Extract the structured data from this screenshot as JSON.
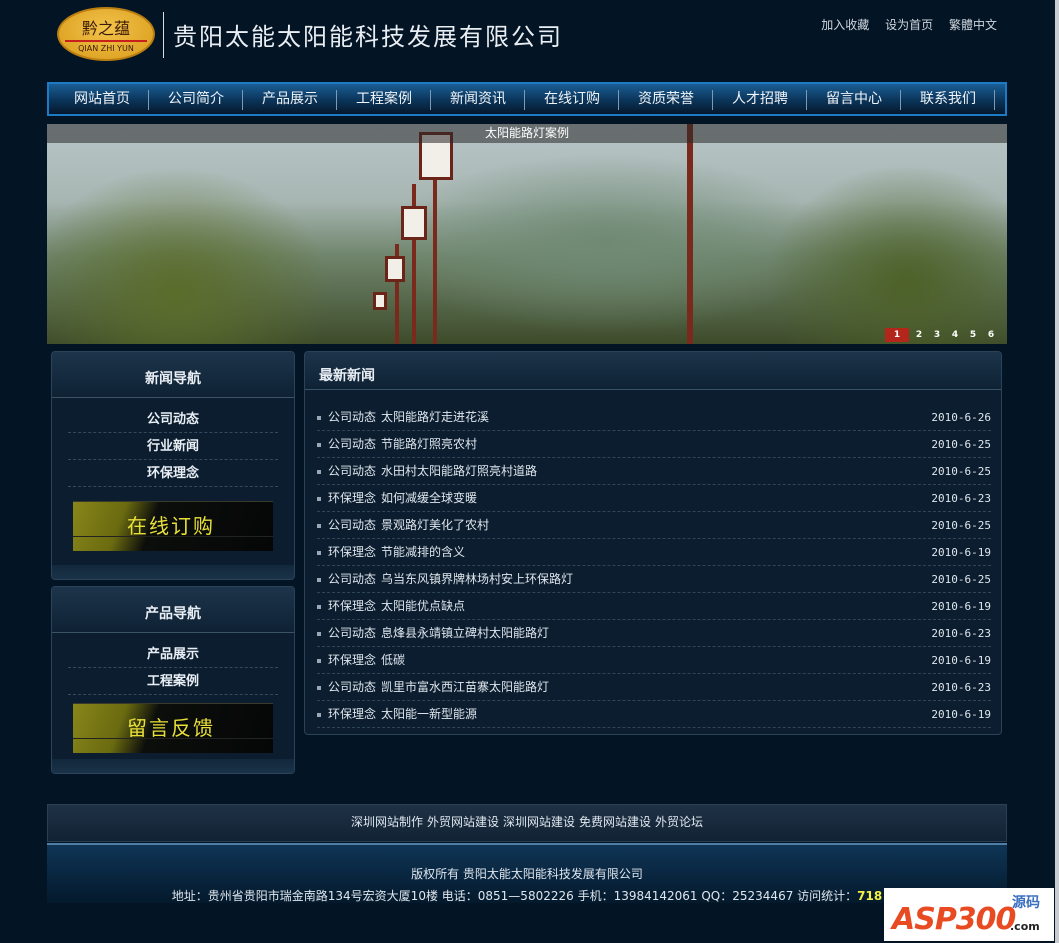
{
  "header": {
    "logo_cn": "黔之蕴",
    "logo_en": "QIAN ZHI YUN",
    "company": "贵阳太能太阳能科技发展有限公司",
    "top_links": [
      "加入收藏",
      "设为首页",
      "繁體中文"
    ]
  },
  "nav": [
    "网站首页",
    "公司简介",
    "产品展示",
    "工程案例",
    "新闻资讯",
    "在线订购",
    "资质荣誉",
    "人才招聘",
    "留言中心",
    "联系我们"
  ],
  "banner": {
    "caption": "太阳能路灯案例",
    "pages": [
      "1",
      "2",
      "3",
      "4",
      "5",
      "6"
    ],
    "active_page": "1"
  },
  "news_nav": {
    "title": "新闻导航",
    "items": [
      "公司动态",
      "行业新闻",
      "环保理念"
    ],
    "promo": "在线订购"
  },
  "product_nav": {
    "title": "产品导航",
    "items": [
      "产品展示",
      "工程案例"
    ],
    "promo": "留言反馈"
  },
  "latest_news": {
    "title": "最新新闻",
    "items": [
      {
        "cat": "公司动态",
        "title": "太阳能路灯走进花溪",
        "date": "2010-6-26"
      },
      {
        "cat": "公司动态",
        "title": "节能路灯照亮农村",
        "date": "2010-6-25"
      },
      {
        "cat": "公司动态",
        "title": "水田村太阳能路灯照亮村道路",
        "date": "2010-6-25"
      },
      {
        "cat": "环保理念",
        "title": "如何减缓全球变暖",
        "date": "2010-6-23"
      },
      {
        "cat": "公司动态",
        "title": "景观路灯美化了农村",
        "date": "2010-6-25"
      },
      {
        "cat": "环保理念",
        "title": "节能减排的含义",
        "date": "2010-6-19"
      },
      {
        "cat": "公司动态",
        "title": "乌当东风镇界牌林场村安上环保路灯",
        "date": "2010-6-25"
      },
      {
        "cat": "环保理念",
        "title": "太阳能优点缺点",
        "date": "2010-6-19"
      },
      {
        "cat": "公司动态",
        "title": "息烽县永靖镇立碑村太阳能路灯",
        "date": "2010-6-23"
      },
      {
        "cat": "环保理念",
        "title": "低碳",
        "date": "2010-6-19"
      },
      {
        "cat": "公司动态",
        "title": "凯里市富水西江苗寨太阳能路灯",
        "date": "2010-6-23"
      },
      {
        "cat": "环保理念",
        "title": "太阳能一新型能源",
        "date": "2010-6-19"
      }
    ]
  },
  "footer_links": [
    "深圳网站制作",
    "外贸网站建设",
    "深圳网站建设",
    "免费网站建设",
    "外贸论坛"
  ],
  "footer": {
    "copyright": "版权所有 贵阳太能太阳能科技发展有限公司",
    "address": "地址：贵州省贵阳市瑞金南路134号宏资大厦10楼 电话：0851—5802226 手机：13984142061 QQ：25234467 访问统计：",
    "visits": "718"
  },
  "watermark": {
    "brand": "ASP300",
    "tag": "源码",
    "domain": ".com"
  }
}
